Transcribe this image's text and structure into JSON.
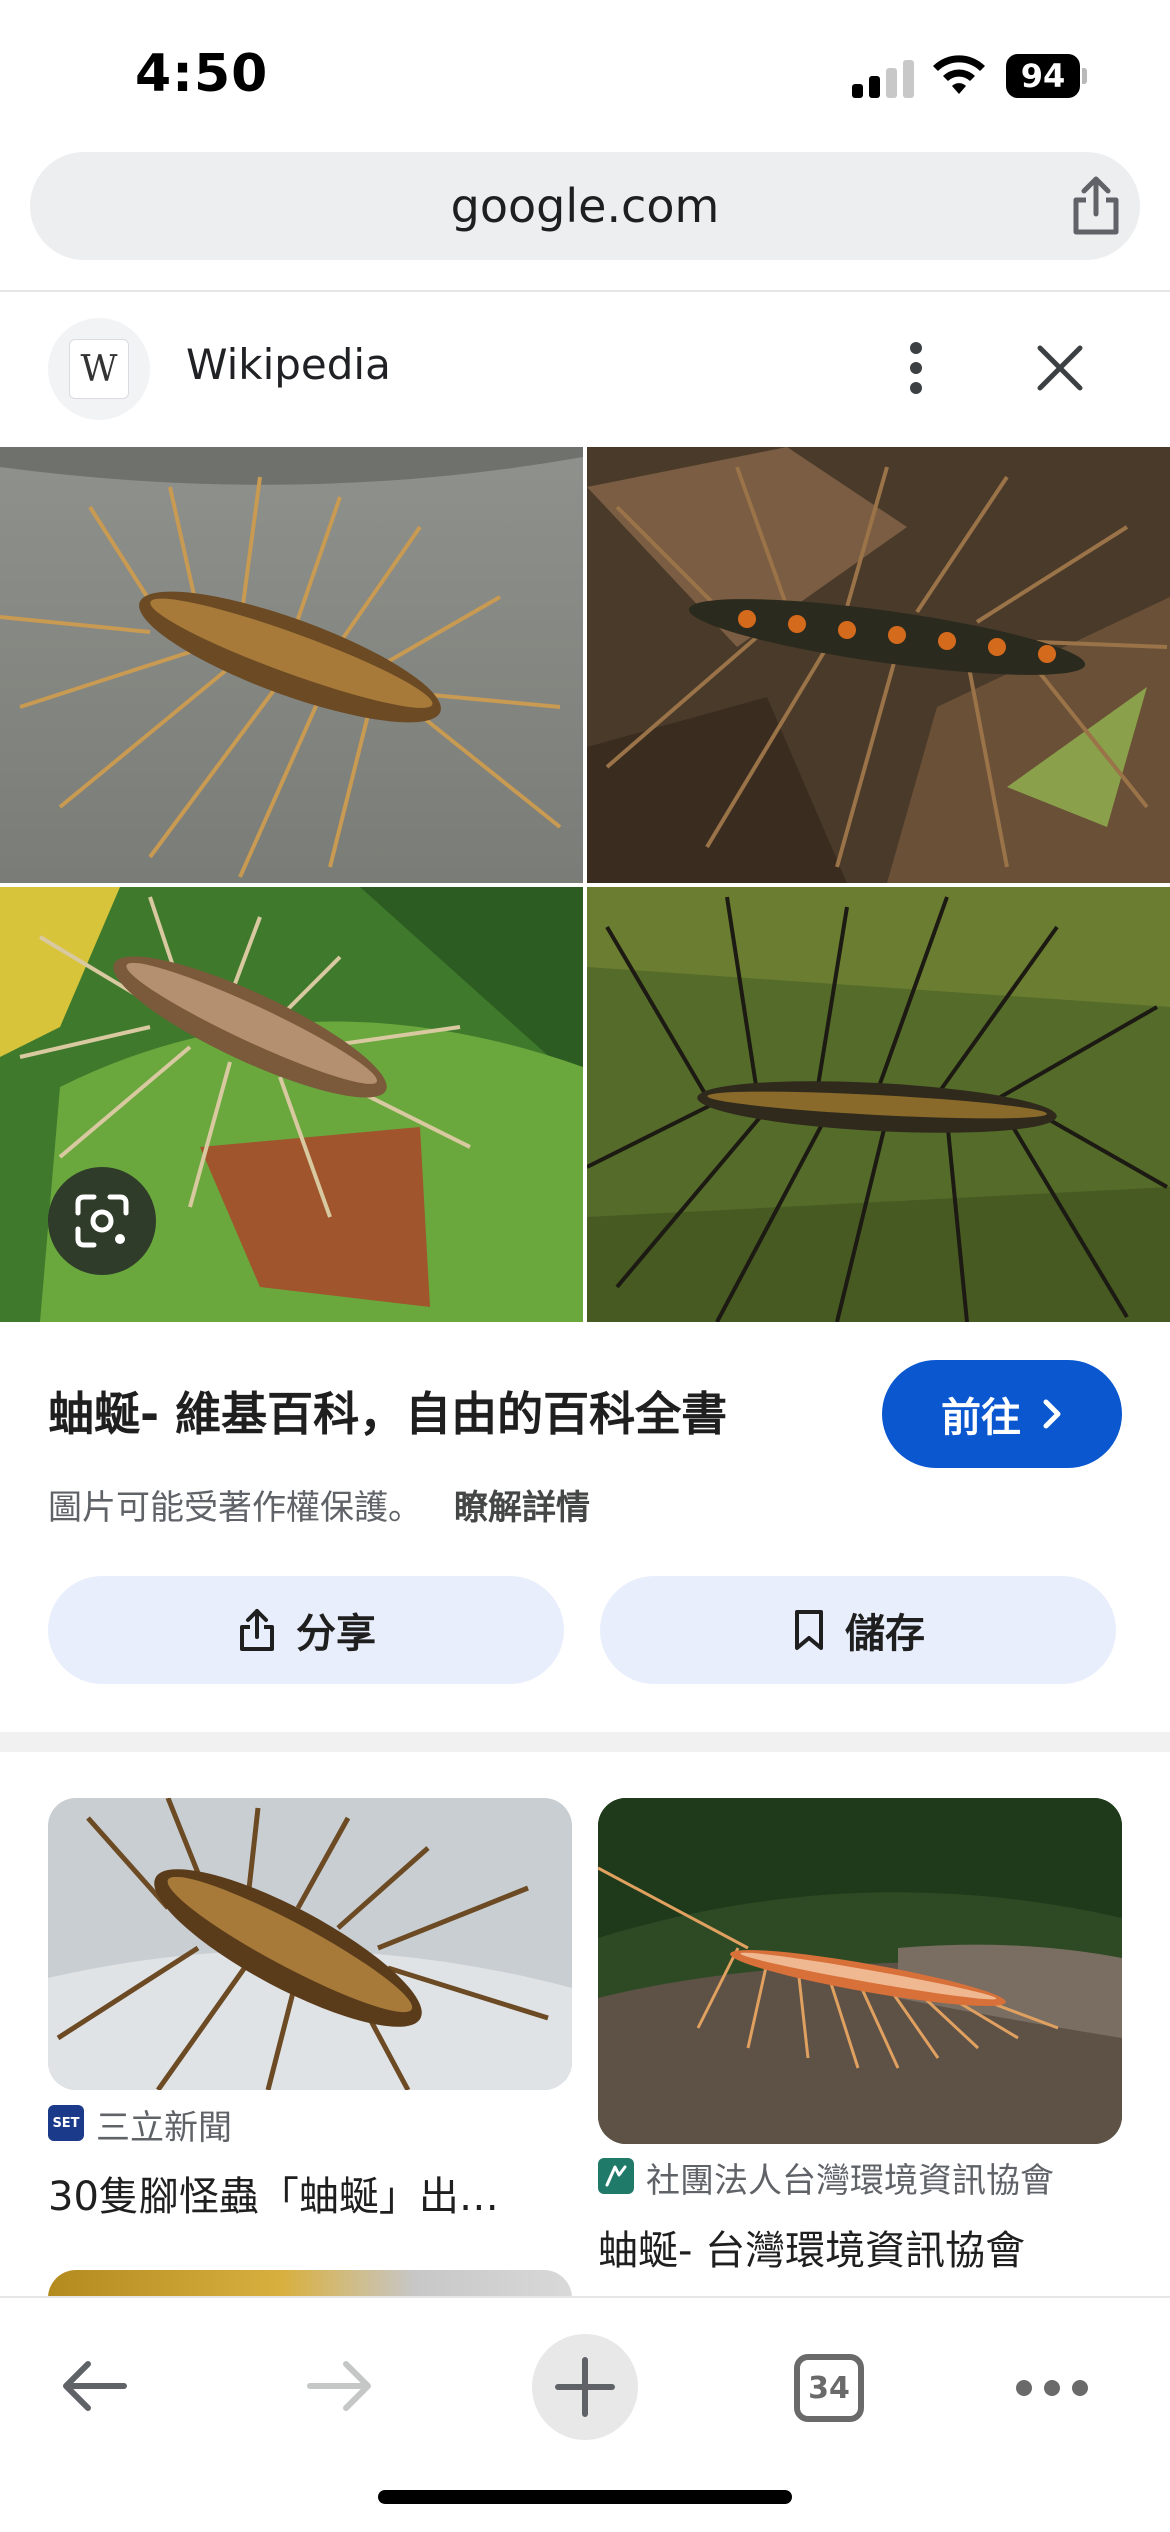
{
  "status_bar": {
    "time": "4:50",
    "battery": "94"
  },
  "url_bar": {
    "url": "google.com"
  },
  "source": {
    "name": "Wikipedia",
    "logo_letter": "W"
  },
  "result": {
    "title": "蚰蜒- 維基百科，自由的百科全書",
    "goto_label": "前往",
    "copyright_notice": "圖片可能受著作權保護。",
    "learn_more": "瞭解詳情",
    "share_label": "分享",
    "save_label": "儲存"
  },
  "related": [
    {
      "source_icon": "SET",
      "source": "三立新聞",
      "title": "30隻腳怪蟲「蚰蜒」出…"
    },
    {
      "source_icon": "taiwan-env-info-icon",
      "source": "社團法人台灣環境資訊協會",
      "title": "蚰蜒- 台灣環境資訊協會"
    }
  ],
  "toolbar": {
    "tab_count": "34"
  },
  "colors": {
    "accent": "#0b57d0",
    "pill_bg": "#e8eefb",
    "url_bar_bg": "#eceef0"
  }
}
